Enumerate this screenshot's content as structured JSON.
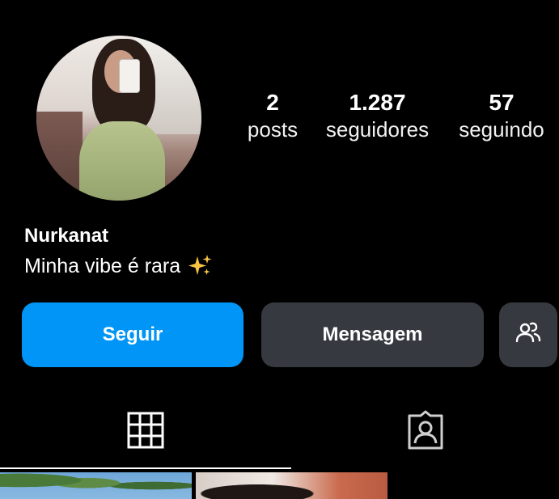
{
  "profile": {
    "username": "Nurkanat",
    "bio": "Minha vibe é rara",
    "bio_emoji": "sparkles-emoji"
  },
  "stats": {
    "posts": {
      "value": "2",
      "label": "posts"
    },
    "followers": {
      "value": "1.287",
      "label": "seguidores"
    },
    "following": {
      "value": "57",
      "label": "seguindo"
    }
  },
  "actions": {
    "follow_label": "Seguir",
    "message_label": "Mensagem",
    "suggest_icon": "add-people-icon"
  },
  "tabs": [
    {
      "name": "posts-grid",
      "icon": "grid-icon",
      "active": true
    },
    {
      "name": "tagged",
      "icon": "tagged-person-icon",
      "active": false
    }
  ],
  "colors": {
    "background": "#000000",
    "primary_button": "#0095f6",
    "secondary_button": "#363a40",
    "text": "#ffffff"
  }
}
